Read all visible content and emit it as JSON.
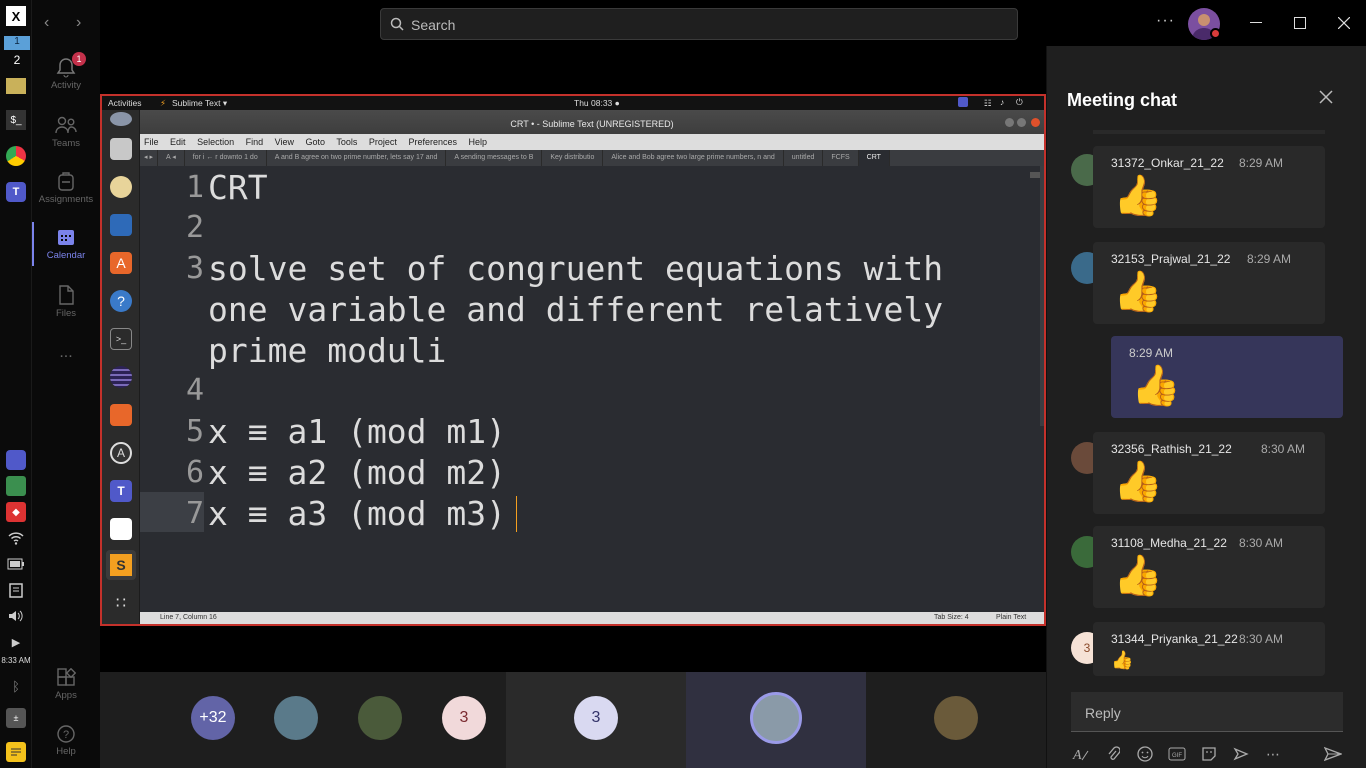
{
  "os_taskbar": {
    "workspaces": [
      "1",
      "2"
    ],
    "clock": "8:33 AM"
  },
  "rail": {
    "items": [
      {
        "label": "Activity",
        "badge": "1"
      },
      {
        "label": "Teams"
      },
      {
        "label": "Assignments"
      },
      {
        "label": "Calendar"
      },
      {
        "label": "Files"
      },
      {
        "label": "..."
      },
      {
        "label": "Apps"
      },
      {
        "label": "Help"
      }
    ]
  },
  "titlebar": {
    "search_placeholder": "Search",
    "more": "···"
  },
  "share": {
    "gnome": {
      "activities": "Activities",
      "app": "Sublime Text ▾",
      "time": "Thu 08:33 ●"
    },
    "window_title": "CRT • - Sublime Text (UNREGISTERED)",
    "menu": [
      "File",
      "Edit",
      "Selection",
      "Find",
      "View",
      "Goto",
      "Tools",
      "Project",
      "Preferences",
      "Help"
    ],
    "tabs": [
      "A ◂",
      "for i ← r downto 1 do",
      "A and B agree on two prime number, lets say 17 and",
      "A sending messages to B",
      "Key distributio",
      "Alice and Bob agree two large prime numbers, n and",
      "untitled",
      "FCFS",
      "CRT"
    ],
    "lines": [
      {
        "n": "1",
        "text": "CRT"
      },
      {
        "n": "2",
        "text": ""
      },
      {
        "n": "3",
        "text": "solve set of congruent equations with"
      },
      {
        "n": "",
        "text": "one variable and different relatively"
      },
      {
        "n": "",
        "text": "prime moduli"
      },
      {
        "n": "4",
        "text": ""
      },
      {
        "n": "5",
        "text": "x ≡ a1 (mod m1)"
      },
      {
        "n": "6",
        "text": "x ≡ a2 (mod m2)"
      },
      {
        "n": "7",
        "text": "x ≡ a3 (mod m3)"
      }
    ],
    "status_left": "Line 7, Column 16",
    "status_tab": "Tab Size: 4",
    "status_syntax": "Plain Text"
  },
  "participants": [
    {
      "label": "+32",
      "color": "#6264a7",
      "text_color": "#ffffff"
    },
    {
      "label": "",
      "color": "#5a7a8a"
    },
    {
      "label": "",
      "color": "#4a5a3a"
    },
    {
      "label": "3",
      "color": "#f1d9da",
      "text_color": "#7a2a30"
    },
    {
      "label": "3",
      "color": "#d9d9f1",
      "text_color": "#33336a"
    },
    {
      "label": "",
      "color": "#8a9aa8"
    },
    {
      "label": "",
      "color": "#6a5a3a"
    }
  ],
  "chat": {
    "title": "Meeting chat",
    "messages": [
      {
        "name": "31372_Onkar_21_22",
        "time": "8:29 AM"
      },
      {
        "name": "32153_Prajwal_21_22",
        "time": "8:29 AM"
      },
      {
        "name": "",
        "time": "8:29 AM",
        "self": true
      },
      {
        "name": "32356_Rathish_21_22",
        "time": "8:30 AM"
      },
      {
        "name": "31108_Medha_21_22",
        "time": "8:30 AM"
      },
      {
        "name": "31344_Priyanka_21_22",
        "time": "8:30 AM",
        "avatar_text": "3"
      }
    ],
    "reply_placeholder": "Reply"
  }
}
